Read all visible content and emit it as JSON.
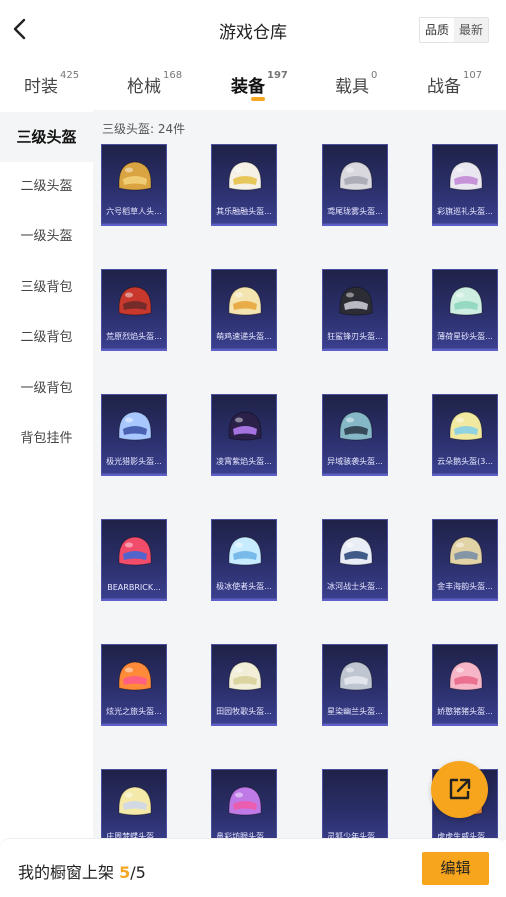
{
  "header": {
    "title": "游戏仓库",
    "sort_options": [
      "品质",
      "最新"
    ],
    "sort_selected": "最新"
  },
  "tabs": [
    {
      "label": "时装",
      "count": "425"
    },
    {
      "label": "枪械",
      "count": "168"
    },
    {
      "label": "装备",
      "count": "197"
    },
    {
      "label": "载具",
      "count": "0"
    },
    {
      "label": "战备",
      "count": "107"
    }
  ],
  "active_tab": "装备",
  "sidebar": {
    "items": [
      "三级头盔",
      "二级头盔",
      "一级头盔",
      "三级背包",
      "二级背包",
      "一级背包",
      "背包挂件"
    ],
    "selected": "三级头盔"
  },
  "section": {
    "title": "三级头盔: 24件"
  },
  "items": [
    {
      "name": "六号稻草人头...",
      "icon": "helmet-icon"
    },
    {
      "name": "其乐融融头盔...",
      "icon": "helmet-icon"
    },
    {
      "name": "鸢尾珑雾头盔...",
      "icon": "helmet-icon"
    },
    {
      "name": "彩旗巡礼头盔...",
      "icon": "helmet-icon"
    },
    {
      "name": "荒原烈焰头盔...",
      "icon": "helmet-icon"
    },
    {
      "name": "萌鸡速递头盔...",
      "icon": "helmet-icon"
    },
    {
      "name": "狂鲨锋刃头盔...",
      "icon": "helmet-icon"
    },
    {
      "name": "薄荷星砂头盔...",
      "icon": "helmet-icon"
    },
    {
      "name": "极光猎影头盔...",
      "icon": "helmet-icon"
    },
    {
      "name": "凌霄紫焰头盔...",
      "icon": "helmet-icon"
    },
    {
      "name": "异域骇袭头盔...",
      "icon": "helmet-icon"
    },
    {
      "name": "云朵鹅头盔(3...",
      "icon": "helmet-icon"
    },
    {
      "name": "BEARBRICK...",
      "icon": "helmet-icon"
    },
    {
      "name": "极冰使者头盔...",
      "icon": "helmet-icon"
    },
    {
      "name": "冰河战士头盔...",
      "icon": "helmet-icon"
    },
    {
      "name": "金丰海韵头盔...",
      "icon": "helmet-icon"
    },
    {
      "name": "炫光之旅头盔...",
      "icon": "helmet-icon"
    },
    {
      "name": "田园牧歌头盔...",
      "icon": "helmet-icon"
    },
    {
      "name": "星染幽兰头盔...",
      "icon": "helmet-icon"
    },
    {
      "name": "娇憨猪猪头盔...",
      "icon": "helmet-icon"
    },
    {
      "name": "庄周梦蝶头盔...",
      "icon": "helmet-icon"
    },
    {
      "name": "鼻彩坊眼头盔...",
      "icon": "helmet-icon"
    },
    {
      "name": "灵狐少年头盔...",
      "icon": "helmet-icon"
    },
    {
      "name": "虎虎生威头盔...",
      "icon": "helmet-icon"
    }
  ],
  "footer": {
    "text_prefix": "我的橱窗上架 ",
    "current": "5",
    "separator": "/",
    "total": "5",
    "edit_label": "编辑"
  },
  "colors": {
    "accent": "#f7a51c",
    "card_bg": "#2b2f6a",
    "content_bg": "#f4f5f7"
  }
}
